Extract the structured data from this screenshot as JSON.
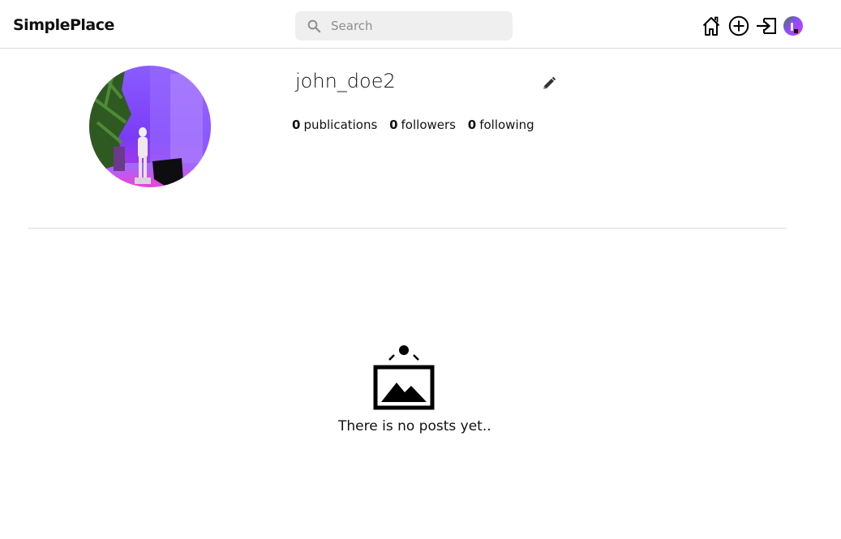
{
  "app": {
    "logo": "SimplePlace"
  },
  "search": {
    "placeholder": "Search",
    "value": ""
  },
  "nav": {
    "icons": [
      "home-icon",
      "add-circle-icon",
      "logout-icon",
      "avatar"
    ]
  },
  "profile": {
    "username": "john_doe2",
    "stats": [
      {
        "count": "0",
        "label": "publications"
      },
      {
        "count": "0",
        "label": "followers"
      },
      {
        "count": "0",
        "label": "following"
      }
    ]
  },
  "posts": {
    "empty_message": "There is no posts yet..",
    "empty_icon": "image-frame-icon"
  },
  "colors": {
    "border": "#dbdbdb",
    "search_bg": "#efefef",
    "placeholder": "#8e8e8e",
    "avatar_purple": "#8b4dff",
    "avatar_magenta": "#c73cf0"
  }
}
